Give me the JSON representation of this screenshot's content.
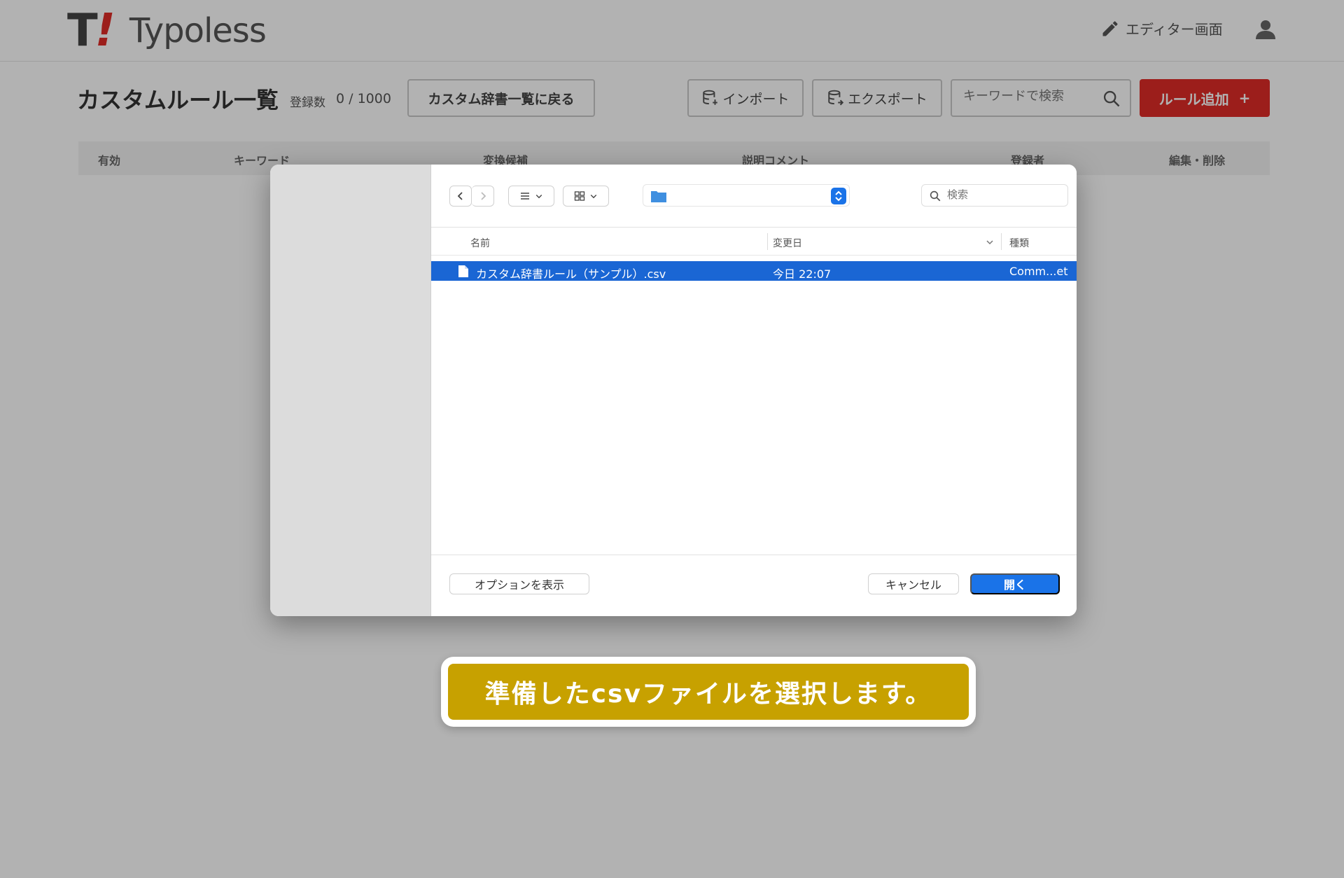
{
  "header": {
    "logo_mark": "T",
    "logo_mark_bang": "!",
    "logo_text_a": "Typo",
    "logo_text_b": "less",
    "editor_link": "エディター画面",
    "colors": {
      "brand_red": "#e02b27"
    }
  },
  "page": {
    "title": "カスタムルール一覧",
    "count_label": "登録数",
    "count_value": "0 / 1000",
    "back_button": "カスタム辞書一覧に戻る",
    "import_button": "インポート",
    "export_button": "エクスポート",
    "search_placeholder": "キーワードで検索",
    "add_button": "ルール追加",
    "add_button_icon": "+",
    "table_columns": [
      "有効",
      "キーワード",
      "変換候補",
      "説明コメント",
      "登録者",
      "編集・削除"
    ]
  },
  "dialog": {
    "search_placeholder": "検索",
    "columns": {
      "name": "名前",
      "modified": "変更日",
      "kind": "種類"
    },
    "files": [
      {
        "name": "カスタム辞書ルール（サンプル）.csv",
        "modified": "今日 22:07",
        "kind": "Comm...et",
        "selected": true
      }
    ],
    "options_button": "オプションを表示",
    "cancel_button": "キャンセル",
    "open_button": "開く",
    "colors": {
      "accent": "#1a73e8",
      "selected_row": "#1a66d4"
    }
  },
  "caption": {
    "text": "準備したcsvファイルを選択します。",
    "color": "#c7a100"
  }
}
